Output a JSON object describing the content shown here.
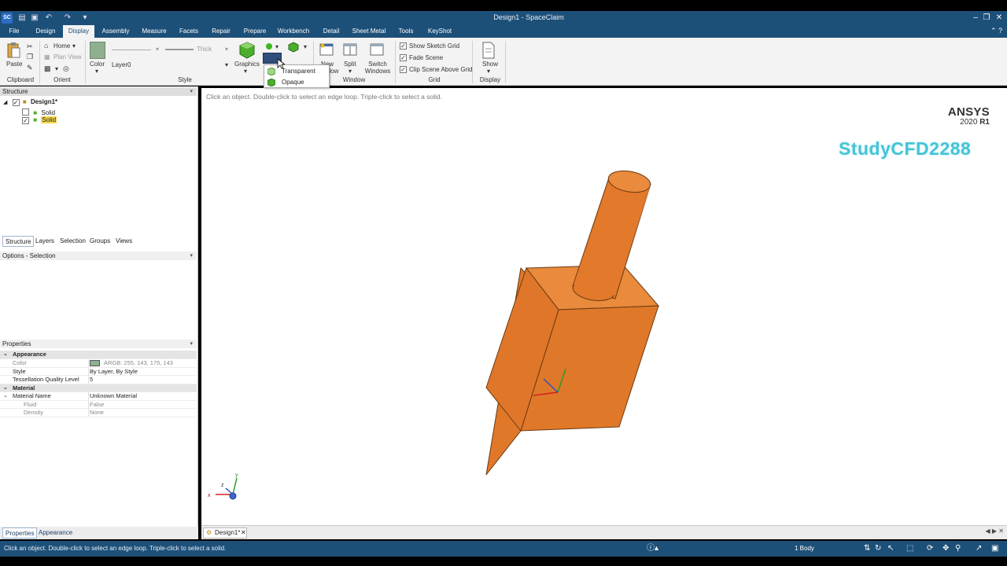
{
  "window": {
    "title": "Design1 - SpaceClaim",
    "app_icon": "spaceclaim-logo",
    "quick_access": [
      "folder-open-icon",
      "save-icon",
      "undo-icon",
      "redo-icon",
      "customize-icon"
    ]
  },
  "menu": {
    "tabs": [
      "File",
      "Design",
      "Display",
      "Assembly",
      "Measure",
      "Facets",
      "Repair",
      "Prepare",
      "Workbench",
      "Detail",
      "Sheet Metal",
      "Tools",
      "KeyShot"
    ],
    "active": "Display"
  },
  "ribbon": {
    "clipboard": {
      "paste": "Paste",
      "group": "Clipboard"
    },
    "orient": {
      "home": "Home",
      "plan_view": "Plan View",
      "group": "Orient"
    },
    "style": {
      "color": "Color",
      "layer": "Layer0",
      "line_weight": "Thick",
      "graphics": "Graphics",
      "group": "Style"
    },
    "window": {
      "new_window": "New Window",
      "split": "Split",
      "switch_windows": "Switch Windows",
      "group": "Window"
    },
    "grid": {
      "show_sketch_grid": "Show Sketch Grid",
      "fade_scene": "Fade Scene",
      "clip_scene": "Clip Scene Above Grid",
      "group": "Grid",
      "checked": [
        true,
        true,
        true
      ]
    },
    "display": {
      "show": "Show",
      "group": "Display"
    }
  },
  "dropdown": {
    "items": [
      "Transparent",
      "Opaque"
    ]
  },
  "structure": {
    "header": "Structure",
    "root": "Design1*",
    "items": [
      {
        "label": "Solid",
        "checked": false
      },
      {
        "label": "Solid",
        "checked": true,
        "highlighted": true
      }
    ],
    "tabs": [
      "Structure",
      "Layers",
      "Selection",
      "Groups",
      "Views"
    ]
  },
  "options": {
    "header": "Options - Selection"
  },
  "properties": {
    "header": "Properties",
    "appearance_cat": "Appearance",
    "material_cat": "Material",
    "rows": {
      "color_key": "Color",
      "color_val": "ARGB: 255, 143, 175, 143",
      "style_key": "Style",
      "style_val": "By Layer, By Style",
      "tess_key": "Tessellation Quality Level",
      "tess_val": "5",
      "matname_key": "Material Name",
      "matname_val": "Unknown Material",
      "fluid_key": "Fluid",
      "fluid_val": "False",
      "density_key": "Density",
      "density_val": "None"
    },
    "swatch_color": "#8faf8f",
    "bottom_tabs": [
      "Properties",
      "Appearance"
    ]
  },
  "viewport": {
    "hint": "Click an object. Double-click to select an edge loop. Triple-click to select a solid.",
    "brand": "ANSYS",
    "version_prefix": "2020 ",
    "version_suffix": "R1",
    "watermark": "StudyCFD2288",
    "model_color": "#e0782a",
    "triad_labels": {
      "x": "x",
      "y": "y",
      "z": "z"
    }
  },
  "doc_tab": {
    "label": "Design1*"
  },
  "status": {
    "message": "Click an object. Double-click to select an edge loop. Triple-click to select a solid.",
    "body_count": "1 Body"
  }
}
